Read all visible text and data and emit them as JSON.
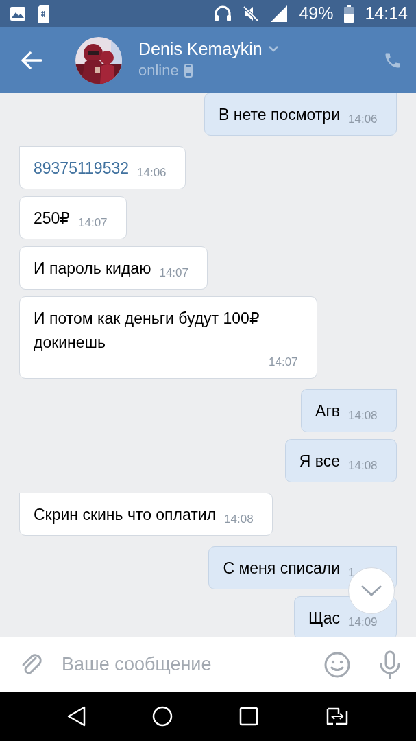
{
  "status_bar": {
    "battery": "49%",
    "time": "14:14"
  },
  "header": {
    "name": "Denis Kemaykin",
    "presence": "online"
  },
  "messages": [
    {
      "outgoing": true,
      "tail": true,
      "kind": "text",
      "text": "В нете посмотри",
      "time": "14:06"
    },
    {
      "outgoing": false,
      "tail": true,
      "kind": "link",
      "text": "89375119532",
      "time": "14:06"
    },
    {
      "outgoing": false,
      "tail": false,
      "kind": "text",
      "text": "250₽",
      "time": "14:07"
    },
    {
      "outgoing": false,
      "tail": false,
      "kind": "text",
      "text": "И пароль кидаю",
      "time": "14:07"
    },
    {
      "outgoing": false,
      "tail": false,
      "kind": "text",
      "text": "И потом как деньги будут 100₽ докинешь",
      "time": "14:07"
    },
    {
      "outgoing": true,
      "tail": true,
      "kind": "text",
      "text": "Агв",
      "time": "14:08"
    },
    {
      "outgoing": true,
      "tail": false,
      "kind": "text",
      "text": "Я все",
      "time": "14:08"
    },
    {
      "outgoing": false,
      "tail": true,
      "kind": "text",
      "text": "Скрин скинь что оплатил",
      "time": "14:08"
    },
    {
      "outgoing": true,
      "tail": true,
      "kind": "text",
      "text": "С меня списали",
      "time": "1"
    },
    {
      "outgoing": true,
      "tail": false,
      "kind": "text",
      "text": "Щас",
      "time": "14:09"
    }
  ],
  "composer": {
    "placeholder": "Ваше сообщение"
  }
}
